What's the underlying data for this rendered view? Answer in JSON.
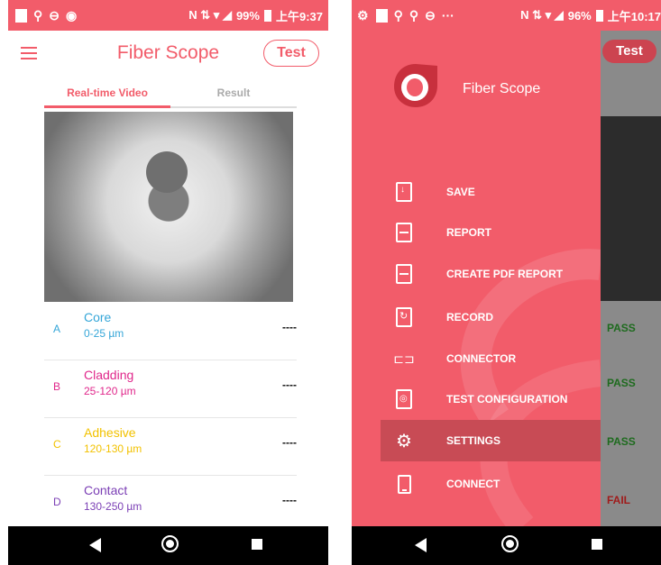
{
  "left_phone": {
    "status": {
      "icons": [
        "wifi-icon",
        "circle-icon",
        "circle-icon"
      ],
      "right_text": "99%",
      "time": "上午9:37",
      "signal": "N ⇅ ▾ ◢"
    },
    "app_title": "Fiber Scope",
    "test_button": "Test",
    "tabs": [
      "Real-time Video",
      "Result"
    ],
    "rows": [
      {
        "letter": "A",
        "name": "Core",
        "range": "0-25 µm",
        "value": "----",
        "color": "#35a6d8"
      },
      {
        "letter": "B",
        "name": "Cladding",
        "range": "25-120 µm",
        "value": "----",
        "color": "#e0278b"
      },
      {
        "letter": "C",
        "name": "Adhesive",
        "range": "120-130 µm",
        "value": "----",
        "color": "#f2c200"
      },
      {
        "letter": "D",
        "name": "Contact",
        "range": "130-250 µm",
        "value": "----",
        "color": "#7b3fb5"
      }
    ]
  },
  "right_phone": {
    "status": {
      "right_text": "96%",
      "time": "上午10:17"
    },
    "background_test_button": "Test",
    "background_results": [
      "PASS",
      "PASS",
      "PASS",
      "FAIL"
    ],
    "drawer": {
      "title": "Fiber Scope",
      "items": [
        {
          "label": "SAVE",
          "icon": "save-icon"
        },
        {
          "label": "REPORT",
          "icon": "report-icon"
        },
        {
          "label": "CREATE PDF REPORT",
          "icon": "pdf-report-icon"
        },
        {
          "label": "RECORD",
          "icon": "record-icon"
        },
        {
          "label": "CONNECTOR",
          "icon": "connector-icon"
        },
        {
          "label": "TEST CONFIGURATION",
          "icon": "test-config-icon"
        },
        {
          "label": "SETTINGS",
          "icon": "gear-icon",
          "selected": true
        },
        {
          "label": "CONNECT",
          "icon": "phone-icon"
        }
      ]
    }
  },
  "colors": {
    "accent": "#f25c6a",
    "selected": "#c84b55",
    "pass": "#1e6b1e",
    "fail": "#a01b1b"
  }
}
